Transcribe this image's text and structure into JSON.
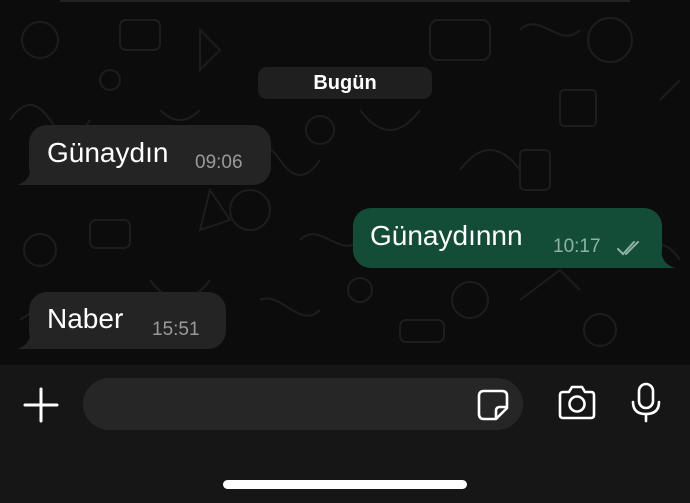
{
  "chat": {
    "date_label": "Bugün",
    "messages": [
      {
        "direction": "incoming",
        "text": "Günaydın",
        "time": "09:06"
      },
      {
        "direction": "outgoing",
        "text": "Günaydınnn",
        "time": "10:17",
        "status": "read"
      },
      {
        "direction": "incoming",
        "text": "Naber",
        "time": "15:51"
      }
    ]
  },
  "input_bar": {
    "add_icon": "plus-icon",
    "sticker_icon": "sticker-icon",
    "camera_icon": "camera-icon",
    "mic_icon": "microphone-icon"
  },
  "colors": {
    "background": "#0b0b0b",
    "incoming_bubble": "#242424",
    "outgoing_bubble": "#134d38",
    "input_bar": "#161616"
  }
}
